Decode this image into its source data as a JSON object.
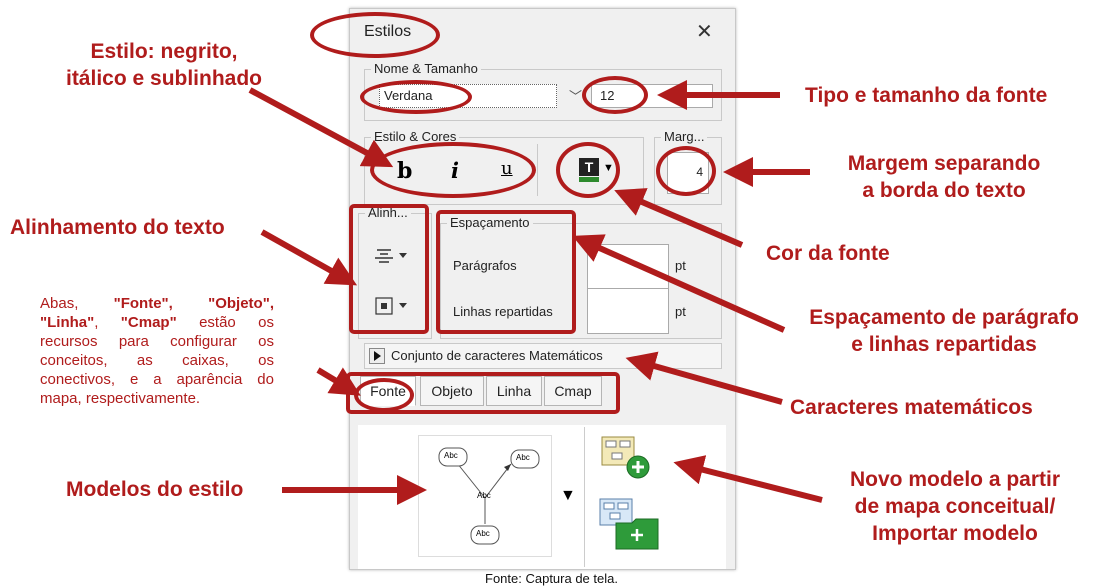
{
  "window": {
    "title": "Estilos",
    "close_glyph": "✕"
  },
  "font_section": {
    "legend": "Nome & Tamanho",
    "font_name": "Verdana",
    "font_size": "12"
  },
  "style_section": {
    "legend": "Estilo & Cores",
    "bold": "b",
    "italic": "i",
    "underline": "u",
    "color_glyph": "T"
  },
  "margin_section": {
    "legend": "Marg...",
    "value": "4"
  },
  "align_section": {
    "legend": "Alinh..."
  },
  "spacing_section": {
    "legend": "Espaçamento",
    "paragraphs_label": "Parágrafos",
    "lines_label": "Linhas repartidas",
    "unit": "pt"
  },
  "math_chars": {
    "label": "Conjunto de caracteres Matemáticos"
  },
  "tabs": [
    {
      "label": "Fonte"
    },
    {
      "label": "Objeto"
    },
    {
      "label": "Linha"
    },
    {
      "label": "Cmap"
    }
  ],
  "template_preview": {
    "node_label": "Abc",
    "center_label": "Abc"
  },
  "callouts": {
    "style": "Estilo: negrito,\nitálico e sublinhado",
    "font_type_size": "Tipo e tamanho da fonte",
    "margin": "Margem separando\na borda do texto",
    "alignment": "Alinhamento do texto",
    "font_color": "Cor da fonte",
    "spacing": "Espaçamento de parágrafo\ne linhas repartidas",
    "math": "Caracteres matemáticos",
    "templates": "Modelos do estilo",
    "new_template": "Novo modelo a partir\nde mapa conceitual/\nImportar modelo"
  },
  "tabs_note": {
    "prefix": "Abas, ",
    "fonte": "\"Fonte\", ",
    "objeto": "\"Objeto\", ",
    "linha": "\"Linha\"",
    "sep": ", ",
    "cmap": "\"Cmap\"",
    "rest": " estão os recursos para configurar os conceitos, as caixas, os conectivos, e a aparência do mapa, respectivamente."
  },
  "caption": "Fonte: Captura de tela.",
  "colors": {
    "annotation_red": "#b01c1c",
    "panel_bg": "#f0f0f0"
  }
}
